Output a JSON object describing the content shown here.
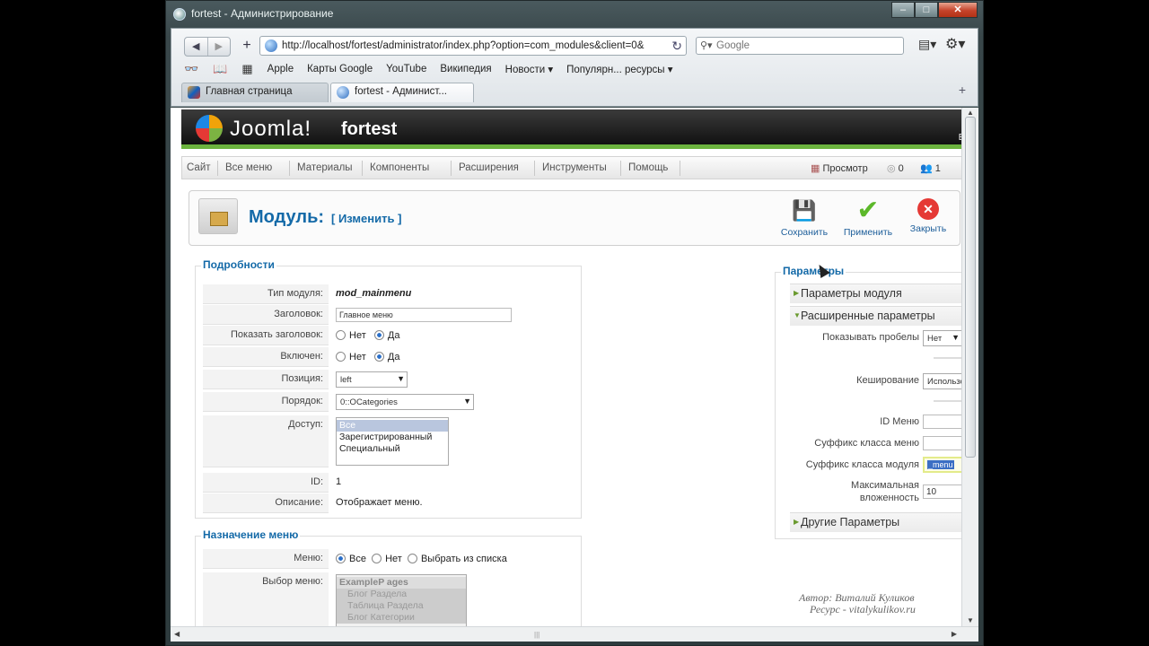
{
  "window": {
    "title": "fortest - Администрирование"
  },
  "browser": {
    "url": "http://localhost/fortest/administrator/index.php?option=com_modules&client=0&",
    "search_placeholder": "Google",
    "bookmarks": [
      "Apple",
      "Карты Google",
      "YouTube",
      "Википедия",
      "Новости ▾",
      "Популярн... ресурсы ▾"
    ],
    "tabs": [
      {
        "label": "Главная страница"
      },
      {
        "label": "fortest - Админист..."
      }
    ]
  },
  "joomla": {
    "brand": "Joomla!",
    "site": "fortest",
    "header_edge": "Ве",
    "menu": [
      "Сайт",
      "Все меню",
      "Материалы",
      "Компоненты",
      "Расширения",
      "Инструменты",
      "Помощь"
    ],
    "preview": "Просмотр",
    "messages": "0",
    "users": "1"
  },
  "toolbar": {
    "title": "Модуль:",
    "subtitle": "[ Изменить ]",
    "save": "Сохранить",
    "apply": "Применить",
    "close": "Закрыть"
  },
  "details": {
    "legend": "Подробности",
    "type_label": "Тип модуля:",
    "type_value": "mod_mainmenu",
    "title_label": "Заголовок:",
    "title_value": "Главное меню",
    "show_title_label": "Показать заголовок:",
    "enabled_label": "Включен:",
    "no": "Нет",
    "yes": "Да",
    "position_label": "Позиция:",
    "position_value": "left",
    "order_label": "Порядок:",
    "order_value": "0::OCategories",
    "access_label": "Доступ:",
    "access_options": [
      "Все",
      "Зарегистрированный",
      "Специальный"
    ],
    "id_label": "ID:",
    "id_value": "1",
    "desc_label": "Описание:",
    "desc_value": "Отображает меню."
  },
  "assign": {
    "legend": "Назначение меню",
    "menus_label": "Меню:",
    "all": "Все",
    "none": "Нет",
    "select": "Выбрать из списка",
    "menu_select_label": "Выбор меню:",
    "menu_options": [
      "ExampleP ages",
      "Блог Раздела",
      "Таблица Раздела",
      "Блог Категории"
    ]
  },
  "params": {
    "legend": "Параметры",
    "module_params": "Параметры модуля",
    "advanced_params": "Расширенные параметры",
    "show_spaces_label": "Показывать пробелы",
    "show_spaces_value": "Нет",
    "caching_label": "Кеширование",
    "caching_value": "Использовать глобальные",
    "menu_id_label": "ID Меню",
    "menu_id_value": "",
    "menu_suffix_label": "Суффикс класса меню",
    "menu_suffix_value": "",
    "module_suffix_label": "Суффикс класса модуля",
    "module_suffix_value": "_menu",
    "max_depth_label_1": "Максимальная",
    "max_depth_label_2": "вложенность",
    "max_depth_value": "10",
    "other_params": "Другие Параметры"
  },
  "watermark": {
    "line1": "Автор: Виталий Куликов",
    "line2": "Ресурс - vitalykulikov.ru"
  },
  "colors": {
    "accent": "#146aa8",
    "header_green": "#6cb33e",
    "close_red": "#e53935",
    "apply_green": "#5cb82a"
  }
}
